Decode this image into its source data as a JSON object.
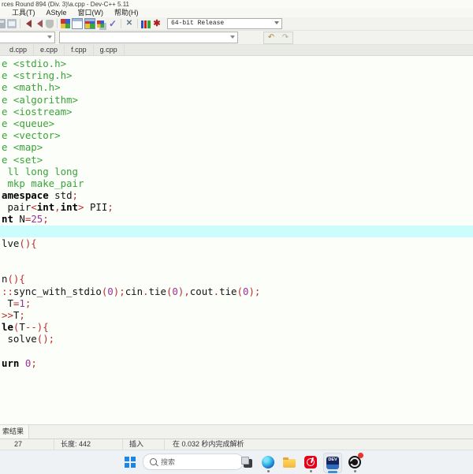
{
  "window": {
    "title": "rces Round 894 (Div. 3)\\a.cpp - Dev-C++ 5.11"
  },
  "menu": {
    "items": [
      "工具(T)",
      "AStyle",
      "窗口(W)",
      "帮助(H)"
    ]
  },
  "toolbar": {
    "compiler_config": "64-bit Release",
    "icons": [
      {
        "name": "printer-icon",
        "kind": "printer"
      },
      {
        "name": "save-icon",
        "kind": "doc"
      },
      {
        "name": "separator"
      },
      {
        "name": "back-icon",
        "kind": "tri-left"
      },
      {
        "name": "forward-icon",
        "kind": "tri-left2"
      },
      {
        "name": "shield-icon",
        "kind": "shield"
      },
      {
        "name": "separator"
      },
      {
        "name": "compile-icon",
        "kind": "grid"
      },
      {
        "name": "run-icon",
        "kind": "window"
      },
      {
        "name": "compile-run-icon",
        "kind": "window-grid"
      },
      {
        "name": "rebuild-all-icon",
        "kind": "grid2"
      },
      {
        "name": "debug-check-icon",
        "kind": "check",
        "glyph": "✓"
      },
      {
        "name": "separator"
      },
      {
        "name": "abort-icon",
        "kind": "cross",
        "glyph": "✕"
      },
      {
        "name": "separator"
      },
      {
        "name": "profile-icon",
        "kind": "chart"
      },
      {
        "name": "delete-profile-icon",
        "kind": "burst",
        "glyph": "✱"
      }
    ],
    "nav_icons": [
      {
        "name": "goto-back-icon",
        "glyph": "↶",
        "color": "#a8863c"
      },
      {
        "name": "goto-forward-icon",
        "glyph": "↷",
        "color": "#b5ab92"
      }
    ],
    "class_combo_value": "",
    "member_combo_value": ""
  },
  "tabs": [
    "d.cpp",
    "e.cpp",
    "f.cpp",
    "g.cpp"
  ],
  "editor": {
    "current_line_index": 14,
    "token_classes": {
      "g": "preprocessor-green",
      "k": "keyword-bold",
      "t": "identifier-black",
      "s": "symbol-red",
      "n": "number-purple"
    },
    "lines": [
      [
        [
          "g",
          "e <stdio.h>"
        ]
      ],
      [
        [
          "g",
          "e <string.h>"
        ]
      ],
      [
        [
          "g",
          "e <math.h>"
        ]
      ],
      [
        [
          "g",
          "e <algorithm>"
        ]
      ],
      [
        [
          "g",
          "e <iostream>"
        ]
      ],
      [
        [
          "g",
          "e <queue>"
        ]
      ],
      [
        [
          "g",
          "e <vector>"
        ]
      ],
      [
        [
          "g",
          "e <map>"
        ]
      ],
      [
        [
          "g",
          "e <set>"
        ]
      ],
      [
        [
          "g",
          " ll long long"
        ]
      ],
      [
        [
          "g",
          " mkp make_pair"
        ]
      ],
      [
        [
          "k",
          "amespace"
        ],
        [
          "t",
          " std"
        ],
        [
          "s",
          ";"
        ]
      ],
      [
        [
          "t",
          " pair"
        ],
        [
          "s",
          "<"
        ],
        [
          "k",
          "int"
        ],
        [
          "s",
          ","
        ],
        [
          "k",
          "int"
        ],
        [
          "s",
          ">"
        ],
        [
          "t",
          " PII"
        ],
        [
          "s",
          ";"
        ]
      ],
      [
        [
          "k",
          "nt"
        ],
        [
          "t",
          " N"
        ],
        [
          "s",
          "="
        ],
        [
          "n",
          "25"
        ],
        [
          "s",
          ";"
        ]
      ],
      [],
      [
        [
          "t",
          "lve"
        ],
        [
          "s",
          "(){"
        ]
      ],
      [],
      [],
      [
        [
          "t",
          "n"
        ],
        [
          "s",
          "(){"
        ]
      ],
      [
        [
          "s",
          "::"
        ],
        [
          "t",
          "sync_with_stdio"
        ],
        [
          "s",
          "("
        ],
        [
          "n",
          "0"
        ],
        [
          "s",
          ");"
        ],
        [
          "t",
          "cin"
        ],
        [
          "s",
          "."
        ],
        [
          "t",
          "tie"
        ],
        [
          "s",
          "("
        ],
        [
          "n",
          "0"
        ],
        [
          "s",
          "),"
        ],
        [
          "t",
          "cout"
        ],
        [
          "s",
          "."
        ],
        [
          "t",
          "tie"
        ],
        [
          "s",
          "("
        ],
        [
          "n",
          "0"
        ],
        [
          "s",
          ");"
        ]
      ],
      [
        [
          "t",
          " T"
        ],
        [
          "s",
          "="
        ],
        [
          "n",
          "1"
        ],
        [
          "s",
          ";"
        ]
      ],
      [
        [
          "s",
          ">>"
        ],
        [
          "t",
          "T"
        ],
        [
          "s",
          ";"
        ]
      ],
      [
        [
          "k",
          "le"
        ],
        [
          "s",
          "("
        ],
        [
          "t",
          "T"
        ],
        [
          "s",
          "--){"
        ]
      ],
      [
        [
          "t",
          " solve"
        ],
        [
          "s",
          "();"
        ]
      ],
      [],
      [
        [
          "k",
          "urn"
        ],
        [
          "t",
          " "
        ],
        [
          "n",
          "0"
        ],
        [
          "s",
          ";"
        ]
      ],
      []
    ]
  },
  "bottom_panel": {
    "tab": "索结果"
  },
  "statusbar": {
    "items": [
      "27",
      "长度: 442",
      "插入",
      "在 0.032 秒内完成解析"
    ]
  },
  "taskbar": {
    "search_placeholder": "搜索",
    "apps": [
      {
        "name": "task-view-button",
        "kind": "taskview",
        "running": false
      },
      {
        "name": "edge-icon",
        "kind": "edge",
        "running": true
      },
      {
        "name": "explorer-icon",
        "kind": "folder",
        "running": false
      },
      {
        "name": "netease-music-icon",
        "kind": "music",
        "running": true
      },
      {
        "name": "devcpp-icon",
        "kind": "dev",
        "label": "DEV",
        "active": true
      },
      {
        "name": "obs-icon",
        "kind": "obs",
        "running": true,
        "badge": true
      }
    ]
  },
  "colors": {
    "syntax_green": "#3aa33a",
    "syntax_red": "#c22b2b",
    "syntax_purple": "#993399",
    "current_line_highlight": "#ccfdfd",
    "taskbar_accent": "#3e8ddd"
  }
}
